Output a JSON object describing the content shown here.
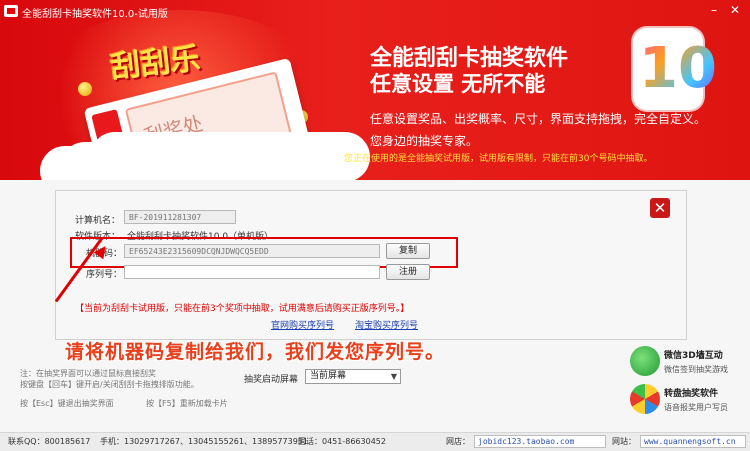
{
  "window": {
    "title": "全能刮刮卡抽奖软件10.0-试用版",
    "minimize": "–",
    "close": "✕"
  },
  "banner": {
    "logo": "刮刮乐",
    "ticket_label": "刮奖处",
    "headline": "全能刮刮卡抽奖软件",
    "subline": "任意设置  无所不能",
    "features": "任意设置奖品、出奖概率、尺寸，界面支持拖拽，完全自定义。",
    "tagline": "您身边的抽奖专家。",
    "notice": "您正在使用的是全能抽奖试用版，试用版有限制，只能在前30个号码中抽取。",
    "version_badge": "10"
  },
  "form": {
    "computer_label": "计算机名：",
    "computer_value": "BF-201911281307",
    "version_label": "软件版本：",
    "version_value": "全能刮刮卡抽奖软件10.0（单机版）",
    "machine_label": "机器码：",
    "machine_value": "EF65243E2315609DCQNJDWQCQ5EDD",
    "copy_button": "复制",
    "serial_label": "序列号：",
    "serial_value": "",
    "register_button": "注册",
    "warning": "【当前为刮刮卡试用版，只能在前3个奖项中抽取，试用满意后请购买正版序列号。】",
    "link_official": "官网购买序列号",
    "link_taobao": "淘宝购买序列号",
    "close_icon": "✕"
  },
  "instruction": "请将机器码复制给我们，我们发您序列号。",
  "notes": {
    "line1": "注：在抽奖界面可以通过鼠标直接刮奖",
    "line2": "按键盘【回车】键开启/关闭刮刮卡拖拽排版功能。",
    "screen_label": "抽奖启动屏幕",
    "screen_value": "当前屏幕",
    "esc_hint": "按【Esc】键退出抽奖界面",
    "f5_hint": "按【F5】重新加载卡片"
  },
  "promos": [
    {
      "title": "微信3D墙互动",
      "subtitle": "微信签到抽奖游戏",
      "icon": "wechat-icon"
    },
    {
      "title": "转盘抽奖软件",
      "subtitle": "语音报奖用户写员",
      "icon": "wheel-icon"
    }
  ],
  "footer": {
    "qq": "联系QQ：800185617",
    "phone": "手机：13029717267、13045155261、13895773951",
    "tel": "固话：0451-86630452",
    "shop_label": "网店：",
    "shop_value": "jobidc123.taobao.com",
    "site_label": "网站：",
    "site_value": "www.quannengsoft.cn"
  },
  "colors": {
    "banner_red": "#e01a16",
    "accent_yellow": "#ffe23c",
    "warning_red": "#e00000",
    "link_blue": "#1a3fb0"
  }
}
